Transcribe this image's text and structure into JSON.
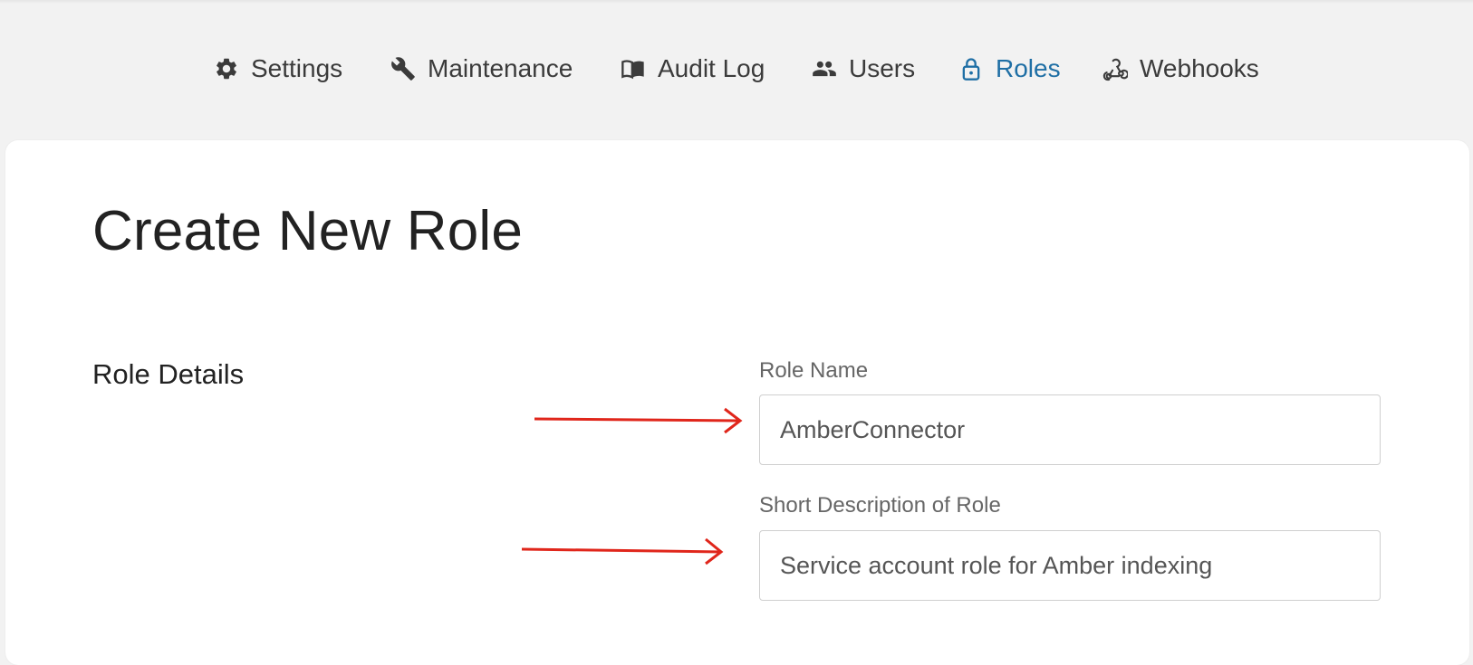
{
  "nav": {
    "items": [
      {
        "label": "Settings",
        "icon": "gear-icon"
      },
      {
        "label": "Maintenance",
        "icon": "wrench-icon"
      },
      {
        "label": "Audit Log",
        "icon": "book-icon"
      },
      {
        "label": "Users",
        "icon": "users-icon"
      },
      {
        "label": "Roles",
        "icon": "lock-icon",
        "active": true
      },
      {
        "label": "Webhooks",
        "icon": "webhook-icon"
      }
    ],
    "active_color": "#1f6fa5",
    "text_color": "#3b3b3b"
  },
  "page": {
    "title": "Create New Role",
    "section_label": "Role Details"
  },
  "form": {
    "role_name": {
      "label": "Role Name",
      "value": "AmberConnector"
    },
    "role_description": {
      "label": "Short Description of Role",
      "value": "Service account role for Amber indexing"
    }
  },
  "annotations": {
    "arrow_color": "#e0261b"
  }
}
